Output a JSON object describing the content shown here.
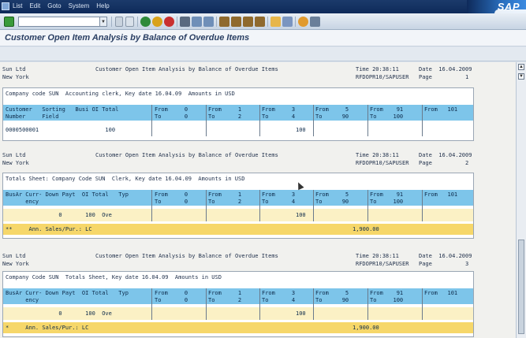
{
  "menu": {
    "items": [
      "List",
      "Edit",
      "Goto",
      "System",
      "Help"
    ]
  },
  "logo": {
    "text": "SAP"
  },
  "toolbar": {
    "command_value": "",
    "buttons": [
      "enter-icon",
      "save-icon",
      "back-icon",
      "exit-icon",
      "cancel-icon",
      "print-icon",
      "find-icon",
      "find-next-icon",
      "first-page-icon",
      "prev-page-icon",
      "next-page-icon",
      "last-page-icon",
      "new-session-icon",
      "shortcut-icon",
      "help-icon",
      "customize-icon"
    ]
  },
  "title": "Customer Open Item Analysis by Balance of Overdue Items",
  "colors": {
    "header_cyan": "#7dc5ea",
    "totals_yellow": "#f6d76a",
    "title_blue": "#2a3f63"
  },
  "sections": [
    {
      "company": "Sun Ltd",
      "city": "New York",
      "report_title": "Customer Open Item Analysis by Balance of Overdue Items",
      "time": "Time 20:38:11",
      "date": "Date  16.04.2009",
      "program": "RFDOPR10/SAPUSER",
      "page": "Page          1",
      "box_title": "Company code SUN  Accounting clerk, Key date 16.04.09  Amounts in USD",
      "col1_top": "Customer   Sorting   Busi OI Total",
      "col1_bot": "Number     Field",
      "buckets": [
        {
          "from": "From     0",
          "to": "To       0"
        },
        {
          "from": "From     1",
          "to": "To       2"
        },
        {
          "from": "From     3",
          "to": "To       4"
        },
        {
          "from": "From     5",
          "to": "To      90"
        },
        {
          "from": "From    91",
          "to": "To     100"
        },
        {
          "from": "From   101",
          "to": ""
        }
      ],
      "row": {
        "c1": "0000500001                    100",
        "b3": "100"
      }
    },
    {
      "company": "Sun Ltd",
      "city": "New York",
      "report_title": "Customer Open Item Analysis by Balance of Overdue Items",
      "time": "Time 20:38:11",
      "date": "Date  16.04.2009",
      "program": "RFDOPR10/SAPUSER",
      "page": "Page          2",
      "box_title": "Totals Sheet: Company Code SUN  Clerk, Key date 16.04.09  Amounts in USD",
      "col1_top": "BusAr Curr- Down Payt  OI Total   Typ",
      "col1_bot": "      ency",
      "buckets": [
        {
          "from": "From     0",
          "to": "To       0"
        },
        {
          "from": "From     1",
          "to": "To       2"
        },
        {
          "from": "From     3",
          "to": "To       4"
        },
        {
          "from": "From     5",
          "to": "To      90"
        },
        {
          "from": "From    91",
          "to": "To     100"
        },
        {
          "from": "From   101",
          "to": ""
        }
      ],
      "row": {
        "c1": "                0       100  Ove",
        "b3": "100"
      },
      "totals": {
        "label": "**     Ann. Sales/Pur.: LC",
        "value": "1,900.00"
      }
    },
    {
      "company": "Sun Ltd",
      "city": "New York",
      "report_title": "Customer Open Item Analysis by Balance of Overdue Items",
      "time": "Time 20:38:11",
      "date": "Date  16.04.2009",
      "program": "RFDOPR10/SAPUSER",
      "page": "Page          3",
      "box_title": "Company Code SUN  Totals Sheet, Key date 16.04.09  Amounts in USD",
      "col1_top": "BusAr Curr- Down Payt  OI Total   Typ",
      "col1_bot": "      ency",
      "buckets": [
        {
          "from": "From     0",
          "to": "To       0"
        },
        {
          "from": "From     1",
          "to": "To       2"
        },
        {
          "from": "From     3",
          "to": "To       4"
        },
        {
          "from": "From     5",
          "to": "To      90"
        },
        {
          "from": "From    91",
          "to": "To     100"
        },
        {
          "from": "From   101",
          "to": ""
        }
      ],
      "row": {
        "c1": "                0       100  Ove",
        "b3": "100"
      },
      "totals": {
        "label": "*     Ann. Sales/Pur.: LC",
        "value": "1,900.00"
      }
    }
  ]
}
